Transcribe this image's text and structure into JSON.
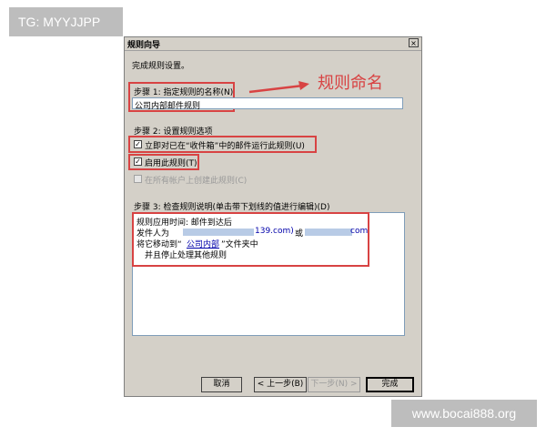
{
  "overlay": {
    "tag": "TG: MYYJJPP",
    "site": "www.bocai888.org"
  },
  "dialog": {
    "title": "规则向导",
    "close": "×",
    "intro": "完成规则设置。",
    "step1": {
      "label": "步骤 1: 指定规则的名称(N)",
      "value": "公司内部邮件规则"
    },
    "step2": {
      "label": "步骤 2: 设置规则选项",
      "option1": "立即对已在“收件箱”中的邮件运行此规则(U)",
      "option2": "启用此规则(T)",
      "option3": "在所有帐户上创建此规则(C)"
    },
    "step3": {
      "label": "步骤 3: 检查规则说明(单击带下划线的值进行编辑)(D)",
      "line1": "规则应用时间: 邮件到达后",
      "line2_prefix": "发件人为",
      "line2_domain1": "139.com)",
      "line2_or": "或",
      "line2_domain2": "com",
      "line3_prefix": "将它移动到“",
      "line3_link": "公司内部",
      "line3_suffix": "”文件夹中",
      "line4": "并且停止处理其他规则"
    },
    "buttons": {
      "cancel": "取消",
      "back": "< 上一步(B)",
      "next": "下一步(N) >",
      "finish": "完成"
    }
  },
  "annotation": {
    "text": "规则命名"
  },
  "colors": {
    "highlight": "#d84343",
    "dialog_bg": "#d4d0c8"
  }
}
